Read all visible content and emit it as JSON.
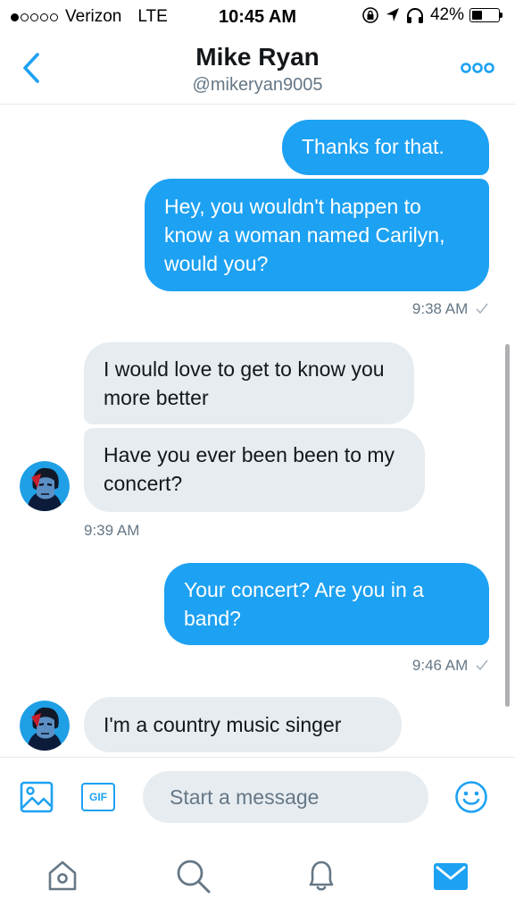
{
  "status_bar": {
    "carrier": "Verizon",
    "network": "LTE",
    "time": "10:45 AM",
    "battery": "42%",
    "battery_level": 0.42,
    "signal_bars": 1
  },
  "header": {
    "name": "Mike Ryan",
    "handle": "@mikeryan9005"
  },
  "messages": [
    {
      "text": "Thanks for that."
    },
    {
      "text": "Hey, you wouldn't happen to know a woman named Carilyn, would you?"
    },
    {
      "timestamp": "9:38 AM"
    },
    {
      "text": "I would love to get to know you more better"
    },
    {
      "text": "Have you ever been been to my concert?"
    },
    {
      "timestamp": "9:39 AM"
    },
    {
      "text": "Your concert? Are you in a band?"
    },
    {
      "timestamp": "9:46 AM"
    },
    {
      "text": "I'm a country music singer"
    }
  ],
  "composer": {
    "placeholder": "Start a message",
    "gif_label": "GIF"
  },
  "colors": {
    "accent": "#1da1f2",
    "incoming_bubble": "#e6ecf0",
    "muted": "#657786"
  },
  "icons": [
    "back-chevron-icon",
    "more-icon",
    "image-icon",
    "gif-icon",
    "emoji-icon",
    "home-icon",
    "search-icon",
    "notifications-icon",
    "messages-icon"
  ]
}
